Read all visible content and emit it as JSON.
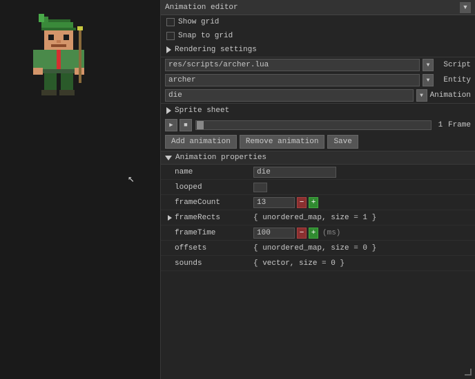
{
  "header": {
    "title": "Animation editor",
    "dropdown_symbol": "▼"
  },
  "checkboxes": {
    "show_grid": "Show grid",
    "snap_to_grid": "Snap to grid"
  },
  "rendering": {
    "label": "Rendering settings"
  },
  "script_row": {
    "value": "res/scripts/archer.lua",
    "label": "Script"
  },
  "entity_row": {
    "value": "archer",
    "label": "Entity"
  },
  "animation_row": {
    "value": "die",
    "label": "Animation"
  },
  "sprite_sheet": {
    "label": "Sprite sheet"
  },
  "frame_controls": {
    "frame_number": "1",
    "frame_label": "Frame",
    "play_symbol": "▶",
    "stop_symbol": "■"
  },
  "buttons": {
    "add": "Add animation",
    "remove": "Remove animation",
    "save": "Save"
  },
  "animation_properties": {
    "label": "Animation properties",
    "name_label": "name",
    "name_value": "die",
    "looped_label": "looped",
    "frame_count_label": "frameCount",
    "frame_count_value": "13",
    "frame_rects_label": "frameRects",
    "frame_rects_value": "{ unordered_map, size = 1 }",
    "frame_time_label": "frameTime",
    "frame_time_value": "100",
    "frame_time_unit": "(ms)",
    "offsets_label": "offsets",
    "offsets_value": "{ unordered_map, size = 0 }",
    "sounds_label": "sounds",
    "sounds_value": "{ vector, size = 0 }",
    "minus_symbol": "−",
    "plus_symbol": "+"
  },
  "icons": {
    "dropdown": "▼",
    "triangle_right": "►",
    "triangle_down": "▼"
  }
}
